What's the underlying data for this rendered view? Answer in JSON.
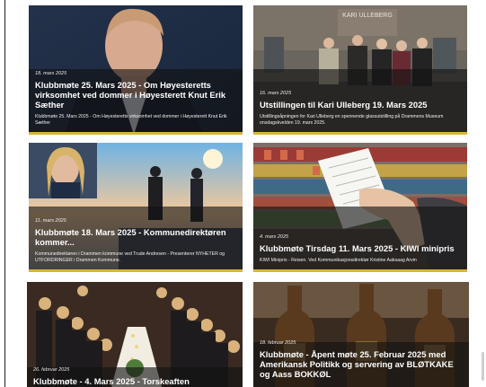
{
  "posts": [
    {
      "date": "18. mars 2025",
      "title": "Klubbmøte 25. Mars 2025 - Om Høyesteretts virksomhet ved dommer i Høyesterett Knut Erik Sæther",
      "excerpt": "Klubbmøte 25. Mars 2025 - Om Høyesteretts virksomhet ved dommer i Høyesterett Knut Erik Sæther"
    },
    {
      "date": "16. mars 2025",
      "title": "Utstillingen til Kari Ulleberg 19. Mars 2025",
      "excerpt": "Utstillingsåpningen for Kari Ulleberg en spennende glassutstilling på Drammens Museum onsdagskvelden 19. mars 2025."
    },
    {
      "date": "11. mars 2025",
      "title": "Klubbmøte 18. Mars 2025 - Kommunedirektøren kommer...",
      "excerpt": "Kommunedirektøren i Drammen kommune ved Trude Andresen - Presenterer NYHETER og UTFORDRINGER i Drammen Kommune."
    },
    {
      "date": "4. mars 2025",
      "title": "Klubbmøte Tirsdag 11. Mars 2025 - KIWI minipris",
      "excerpt": "KIWI Minipris - Reisen. Ved Kommunikasjonsdirektør Kristine Aaksaag Arvin"
    },
    {
      "date": "26. februar 2025",
      "title": "Klubbmøte - 4. Mars 2025 - Torskeaften",
      "excerpt": ""
    },
    {
      "date": "18. februar 2025",
      "title": "Klubbmøte - Åpent møte 25. Februar 2025 med Amerikansk Politikk og servering av BLØTKAKE og Aass BOKKØL",
      "excerpt": ""
    }
  ],
  "photos": {
    "exhibition_sign": "KARI ULLEBERG"
  },
  "colors": {
    "accent": "#d9b531",
    "overlay": "#121212"
  }
}
